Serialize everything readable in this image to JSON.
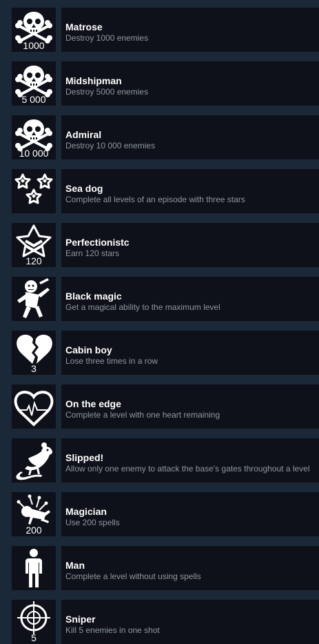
{
  "achievements": [
    {
      "title": "Matrose",
      "desc": "Destroy 1000 enemies",
      "icon": "skull-crossbones-icon",
      "number": "1000"
    },
    {
      "title": "Midshipman",
      "desc": "Destroy 5000 enemies",
      "icon": "skull-crossbones-icon",
      "number": "5 000"
    },
    {
      "title": "Admiral",
      "desc": "Destroy 10 000 enemies",
      "icon": "skull-crossbones-icon",
      "number": "10 000"
    },
    {
      "title": "Sea dog",
      "desc": "Complete all levels of an episode with three stars",
      "icon": "three-stars-icon",
      "number": ""
    },
    {
      "title": "Perfectionistc",
      "desc": "Earn 120 stars",
      "icon": "star-badge-icon",
      "number": "120"
    },
    {
      "title": "Black magic",
      "desc": "Get a magical ability to the maximum level",
      "icon": "voodoo-doll-icon",
      "number": ""
    },
    {
      "title": "Cabin boy",
      "desc": "Lose three times in a row",
      "icon": "broken-heart-icon",
      "number": "3"
    },
    {
      "title": "On the edge",
      "desc": "Complete a level with one heart remaining",
      "icon": "heartbeat-icon",
      "number": ""
    },
    {
      "title": "Slipped!",
      "desc": "Allow only one enemy to attack the base's gates throughout a level",
      "icon": "rat-icon",
      "number": ""
    },
    {
      "title": "Magician",
      "desc": "Use 200 spells",
      "icon": "pinned-doll-icon",
      "number": "200"
    },
    {
      "title": "Man",
      "desc": "Complete a level without using spells",
      "icon": "man-icon",
      "number": ""
    },
    {
      "title": "Sniper",
      "desc": "Kill 5 enemies in one shot",
      "icon": "crosshair-icon",
      "number": "5"
    }
  ]
}
